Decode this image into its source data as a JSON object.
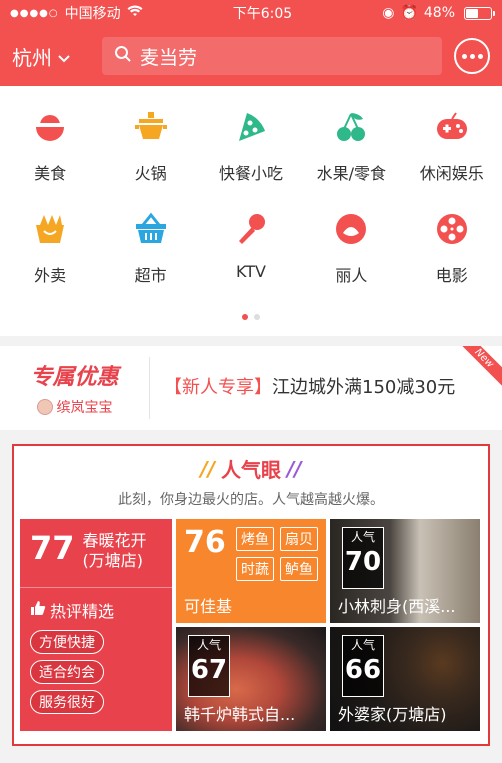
{
  "status": {
    "carrier": "中国移动",
    "time": "下午6:05",
    "battery": "48%"
  },
  "header": {
    "city": "杭州",
    "search_placeholder": "麦当劳"
  },
  "categories": [
    {
      "label": "美食",
      "icon": "food-bowl-icon",
      "color": "#f35050"
    },
    {
      "label": "火锅",
      "icon": "hotpot-icon",
      "color": "#f5a623"
    },
    {
      "label": "快餐小吃",
      "icon": "pizza-slice-icon",
      "color": "#2fb88a"
    },
    {
      "label": "水果/零食",
      "icon": "cherry-icon",
      "color": "#2fb88a"
    },
    {
      "label": "休闲娱乐",
      "icon": "gamepad-icon",
      "color": "#f35050"
    },
    {
      "label": "外卖",
      "icon": "takeout-box-icon",
      "color": "#f5a623"
    },
    {
      "label": "超市",
      "icon": "basket-icon",
      "color": "#2aa7e0"
    },
    {
      "label": "KTV",
      "icon": "microphone-icon",
      "color": "#f35050"
    },
    {
      "label": "丽人",
      "icon": "beauty-icon",
      "color": "#f35050"
    },
    {
      "label": "电影",
      "icon": "film-reel-icon",
      "color": "#f35050"
    }
  ],
  "promo": {
    "title": "专属优惠",
    "user": "缤岚宝宝",
    "tag": "【新人专享】",
    "text": "江边城外满150减30元",
    "ribbon": "New"
  },
  "hot": {
    "title": "人气眼",
    "subtitle": "此刻，你身边最火的店。人气越高越火爆。",
    "featured": {
      "score": "77",
      "name": "春暖花开(万塘店)",
      "hot_label": "热评精选",
      "tags": [
        "方便快捷",
        "适合约会",
        "服务很好"
      ]
    },
    "shops": [
      {
        "score": "76",
        "name": "可佳基",
        "tags": [
          "烤鱼",
          "扇贝",
          "时蔬",
          "鲈鱼"
        ]
      },
      {
        "badge_label": "人气",
        "score": "70",
        "name": "小林刺身(西溪..."
      },
      {
        "badge_label": "人气",
        "score": "67",
        "name": "韩千炉韩式自..."
      },
      {
        "badge_label": "人气",
        "score": "66",
        "name": "外婆家(万塘店)"
      }
    ]
  }
}
